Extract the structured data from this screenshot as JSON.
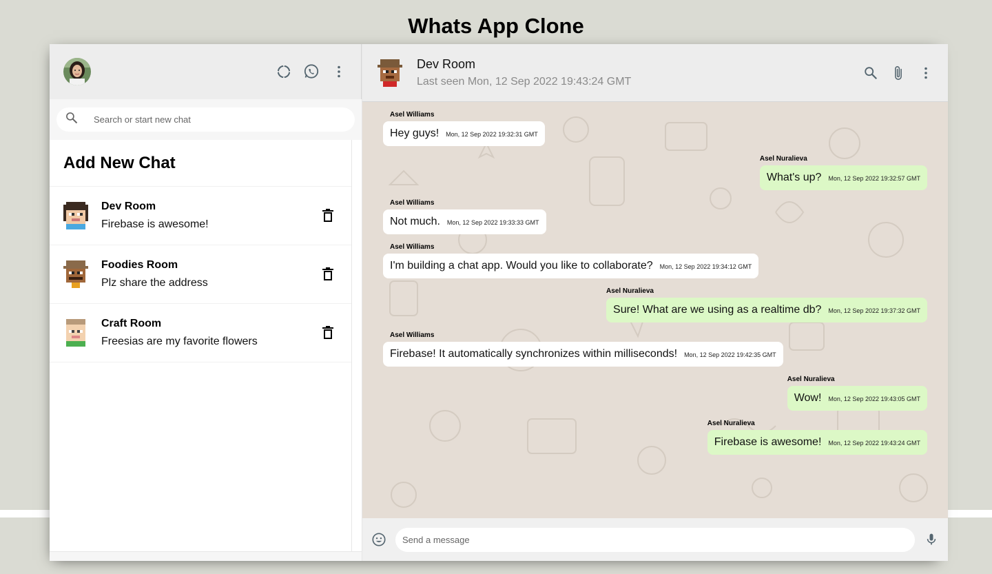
{
  "page": {
    "title": "Whats App Clone"
  },
  "sidebar": {
    "search": {
      "placeholder": "Search or start new chat"
    },
    "add_chat_label": "Add New Chat",
    "chats": [
      {
        "name": "Dev Room",
        "last_message": "Firebase is awesome!"
      },
      {
        "name": "Foodies Room",
        "last_message": "Plz share the address"
      },
      {
        "name": "Craft Room",
        "last_message": "Freesias are my favorite flowers"
      }
    ]
  },
  "chat": {
    "header": {
      "name": "Dev Room",
      "last_seen": "Last seen Mon, 12 Sep 2022 19:43:24 GMT"
    },
    "messages": [
      {
        "sender": "Asel Williams",
        "text": "Hey guys!",
        "time": "Mon, 12 Sep 2022 19:32:31 GMT",
        "mine": false
      },
      {
        "sender": "Asel Nuralieva",
        "text": "What's up?",
        "time": "Mon, 12 Sep 2022 19:32:57 GMT",
        "mine": true
      },
      {
        "sender": "Asel Williams",
        "text": "Not much.",
        "time": "Mon, 12 Sep 2022 19:33:33 GMT",
        "mine": false
      },
      {
        "sender": "Asel Williams",
        "text": "I'm building a chat app. Would you like to collaborate?",
        "time": "Mon, 12 Sep 2022 19:34:12 GMT",
        "mine": false
      },
      {
        "sender": "Asel Nuralieva",
        "text": "Sure! What are we using as a realtime db?",
        "time": "Mon, 12 Sep 2022 19:37:32 GMT",
        "mine": true
      },
      {
        "sender": "Asel Williams",
        "text": "Firebase! It automatically synchronizes within milliseconds!",
        "time": "Mon, 12 Sep 2022 19:42:35 GMT",
        "mine": false
      },
      {
        "sender": "Asel Nuralieva",
        "text": "Wow!",
        "time": "Mon, 12 Sep 2022 19:43:05 GMT",
        "mine": true
      },
      {
        "sender": "Asel Nuralieva",
        "text": "Firebase is awesome!",
        "time": "Mon, 12 Sep 2022 19:43:24 GMT",
        "mine": true
      }
    ],
    "input": {
      "placeholder": "Send a message"
    }
  },
  "colors": {
    "page_background": "#dadbd3",
    "header_background": "#ededed",
    "chat_background": "#e5ddd5",
    "own_bubble": "#dcf8c6",
    "other_bubble": "#ffffff"
  },
  "icons": {
    "sidebar_header": [
      "status-icon",
      "whatsapp-icon",
      "more-vert-icon"
    ],
    "chat_header": [
      "search-icon",
      "attach-icon",
      "more-vert-icon"
    ],
    "footer": [
      "emoji-icon",
      "mic-icon"
    ],
    "chat_item": "delete-icon"
  }
}
